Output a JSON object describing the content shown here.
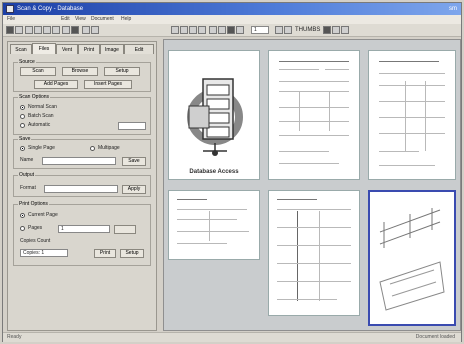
{
  "window": {
    "title": "Scan & Copy - Database",
    "corner_text": "sm"
  },
  "menu": [
    "File",
    "Edit",
    "View",
    "Document",
    "Help"
  ],
  "toolbar": {
    "zoom_value": "1",
    "thumbs_label": "THUMBS"
  },
  "left_panel": {
    "tabs": [
      "Scan",
      "Files",
      "Vent",
      "Print",
      "Image",
      "Edit"
    ],
    "active_tab": 1,
    "source_group": {
      "label": "Source",
      "buttons": [
        "Scan",
        "Browse",
        "Setup",
        "Add Pages",
        "Insert Pages"
      ]
    },
    "settings_group": {
      "label": "Scan Options",
      "options": [
        "Normal Scan",
        "Batch Scan",
        "Automatic"
      ]
    },
    "save_group": {
      "label": "Save",
      "options": [
        "Single Page",
        "Multipage"
      ],
      "name_label": "Name",
      "button": "Save"
    },
    "output_group": {
      "label": "Output",
      "label_text": "Format",
      "button": "Apply"
    },
    "print_group": {
      "label": "Print Options",
      "options": [
        "Current Page",
        "Pages"
      ],
      "pages_value": "1",
      "copies_label": "Copies Count",
      "copies_text": "Copies: 1",
      "buttons": [
        "Print",
        "Setup"
      ]
    }
  },
  "viewer": {
    "thumbnails": [
      {
        "kind": "logo",
        "caption": "Database Access"
      },
      {
        "kind": "doc"
      },
      {
        "kind": "doc"
      },
      {
        "kind": "doc"
      },
      {
        "kind": "doc"
      },
      {
        "kind": "doc",
        "selected": true
      }
    ]
  },
  "status": {
    "left": "Ready",
    "right": "Document loaded"
  }
}
